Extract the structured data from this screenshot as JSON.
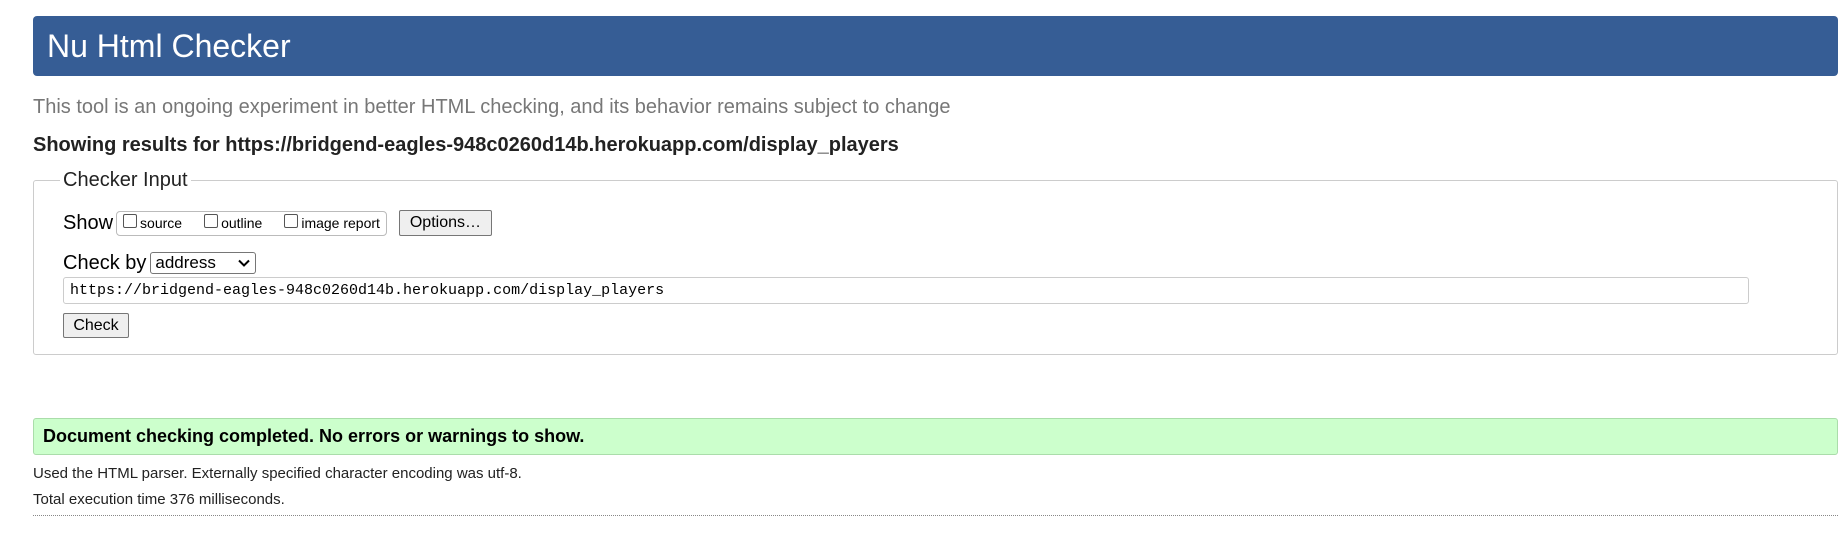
{
  "header": {
    "title": "Nu Html Checker"
  },
  "intro": {
    "subtitle": "This tool is an ongoing experiment in better HTML checking, and its behavior remains subject to change",
    "results_for": "Showing results for https://bridgend-eagles-948c0260d14b.herokuapp.com/display_players"
  },
  "checker_input": {
    "legend": "Checker Input",
    "show_label": "Show",
    "options": [
      {
        "label": "source",
        "checked": false
      },
      {
        "label": "outline",
        "checked": false
      },
      {
        "label": "image report",
        "checked": false
      }
    ],
    "options_button": "Options…",
    "check_by_label": "Check by",
    "check_by_value": "address",
    "url_value": "https://bridgend-eagles-948c0260d14b.herokuapp.com/display_players",
    "check_button": "Check"
  },
  "results": {
    "success_message": "Document checking completed. No errors or warnings to show.",
    "parser_info": "Used the HTML parser. Externally specified character encoding was utf-8.",
    "execution_time": "Total execution time 376 milliseconds."
  },
  "colors": {
    "title_bar": "#365d95",
    "success_bg": "#ccffcc",
    "subtitle_text": "#777777"
  },
  "icons": {
    "select_arrow": "chevron-down-icon"
  }
}
